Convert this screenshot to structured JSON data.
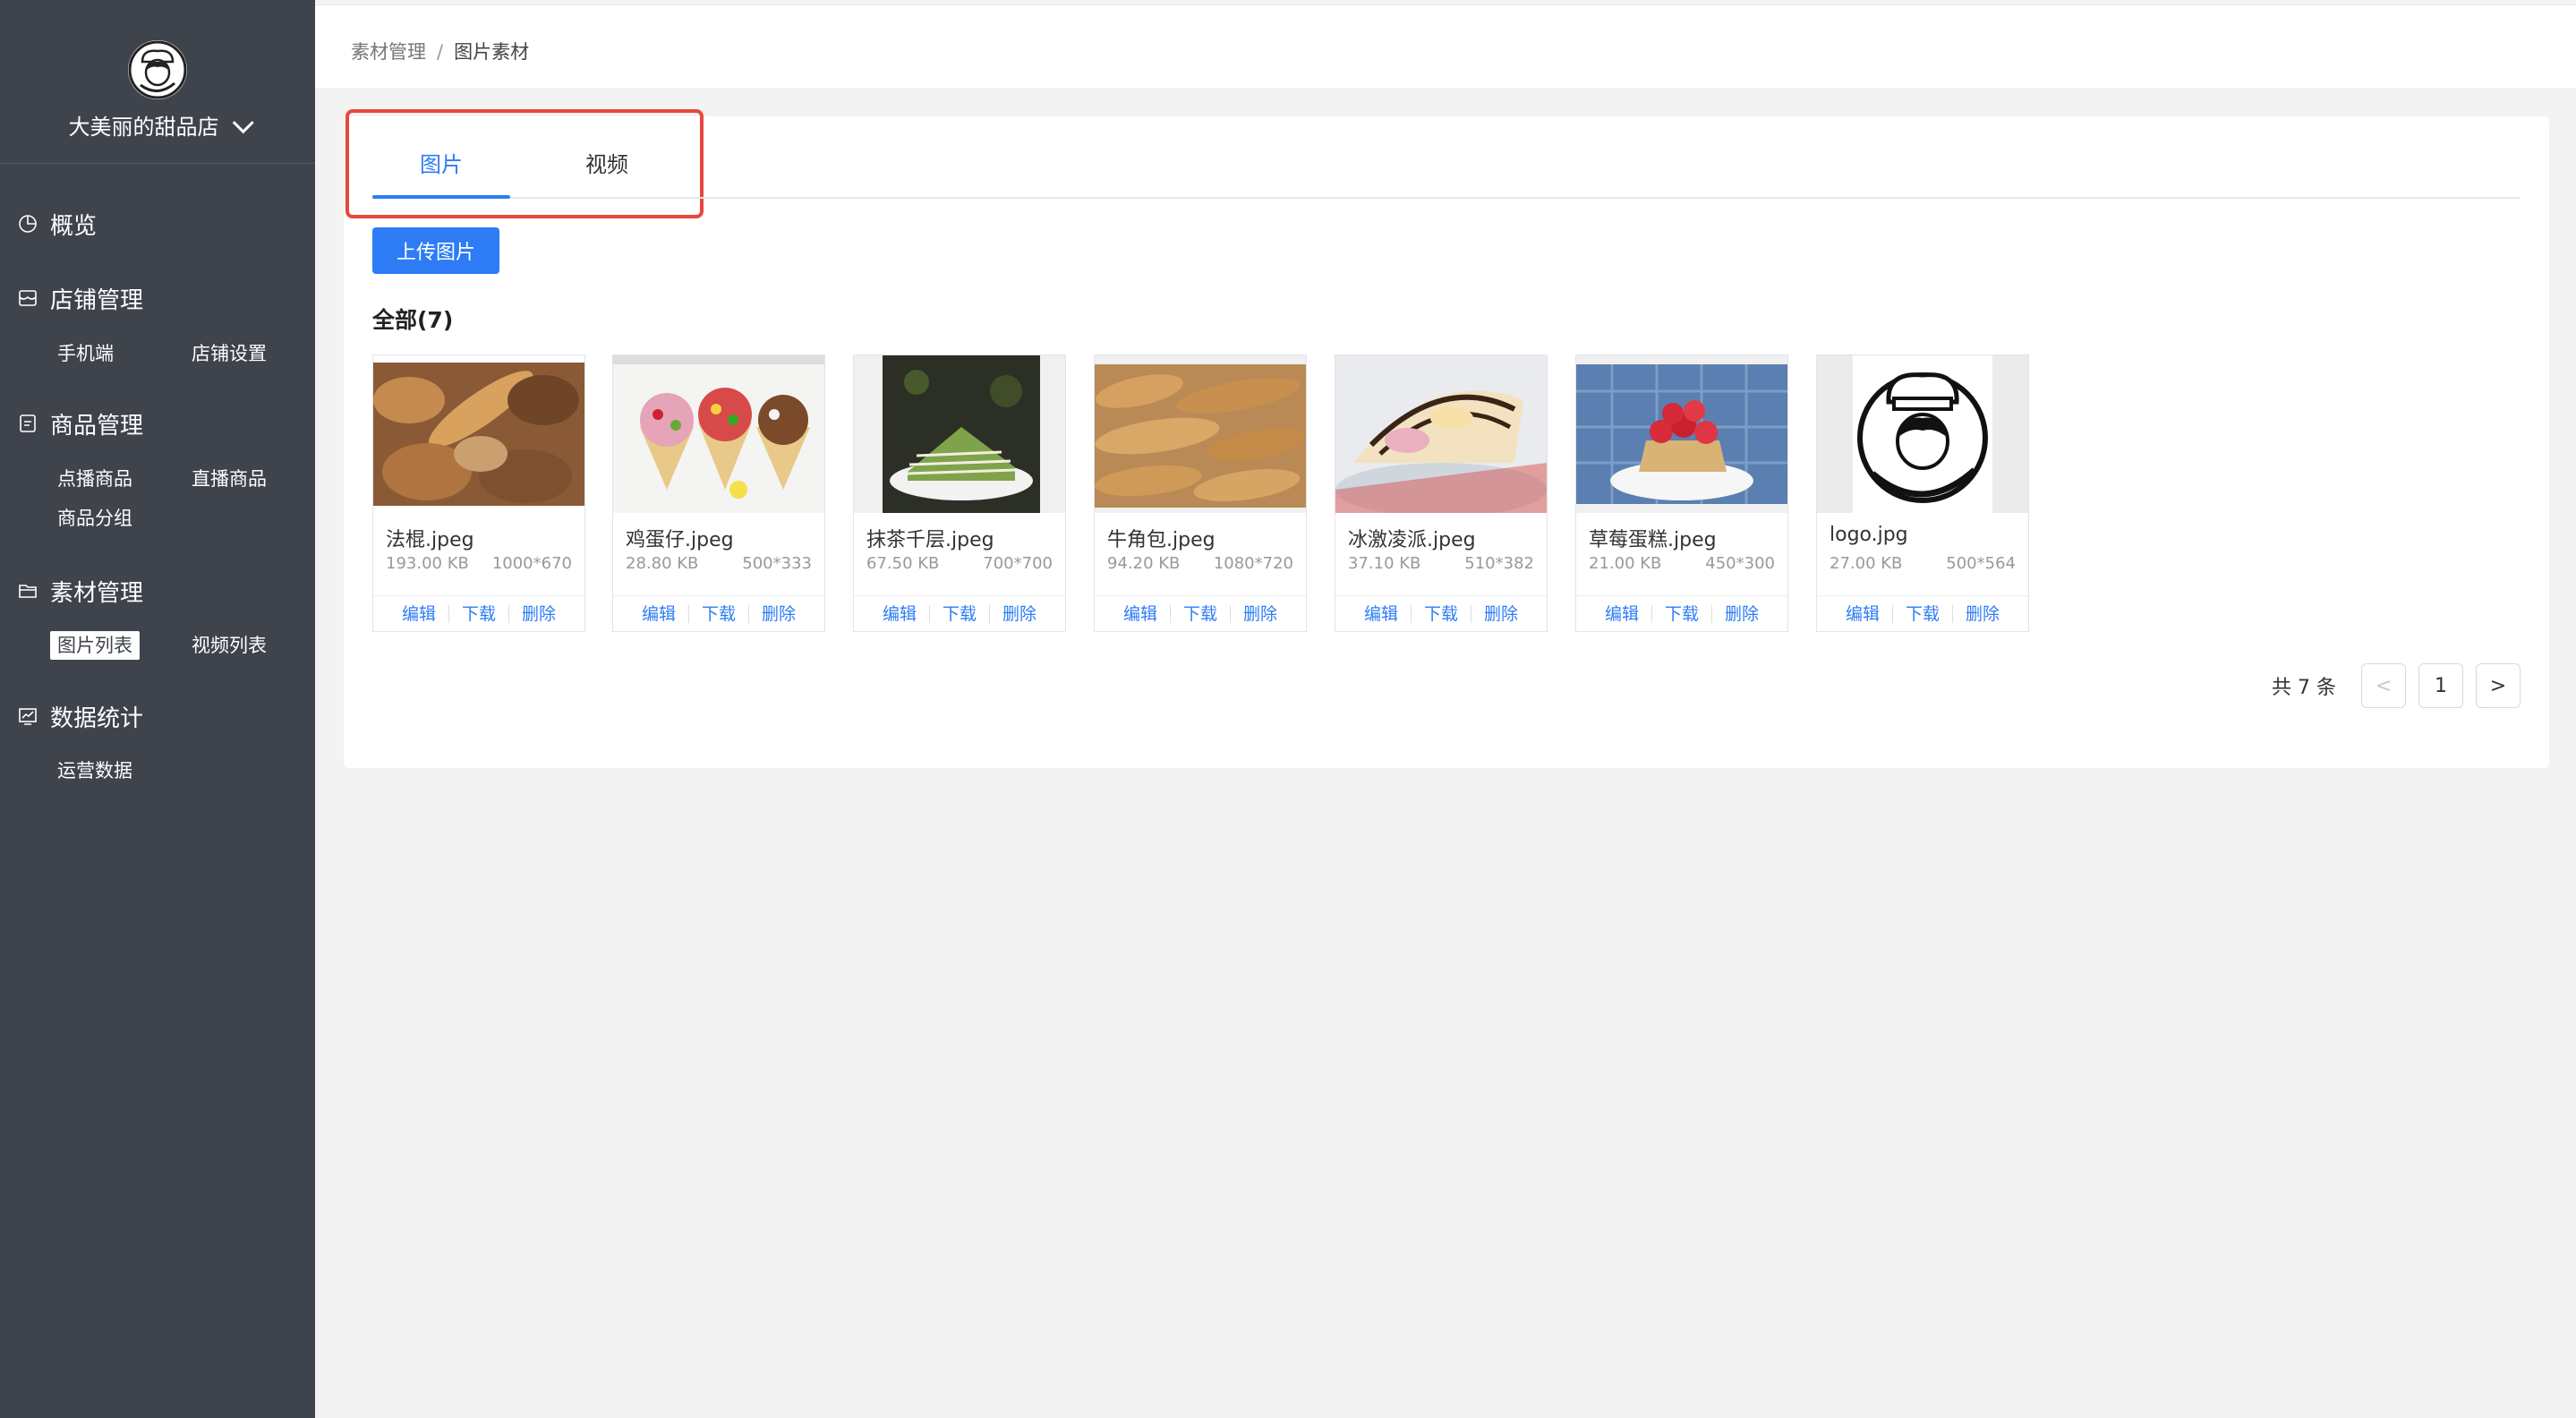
{
  "sidebar": {
    "shop_name": "大美丽的甜品店",
    "menu": [
      {
        "title": "概览",
        "icon": "pie-chart-icon",
        "items": []
      },
      {
        "title": "店铺管理",
        "icon": "store-icon",
        "items": [
          "手机端",
          "店铺设置"
        ]
      },
      {
        "title": "商品管理",
        "icon": "clipboard-icon",
        "items": [
          "点播商品",
          "直播商品",
          "商品分组"
        ]
      },
      {
        "title": "素材管理",
        "icon": "folder-icon",
        "items": [
          "图片列表",
          "视频列表"
        ]
      },
      {
        "title": "数据统计",
        "icon": "chart-icon",
        "items": [
          "运营数据"
        ]
      }
    ],
    "active_item": "图片列表"
  },
  "breadcrumb": {
    "parent": "素材管理",
    "separator": "/",
    "current": "图片素材"
  },
  "tabs": [
    {
      "label": "图片",
      "active": true
    },
    {
      "label": "视频",
      "active": false
    }
  ],
  "upload_label": "上传图片",
  "all_label": "全部(7)",
  "images": [
    {
      "name": "法棍.jpeg",
      "size": "193.00 KB",
      "dim": "1000*670"
    },
    {
      "name": "鸡蛋仔.jpeg",
      "size": "28.80 KB",
      "dim": "500*333"
    },
    {
      "name": "抹茶千层.jpeg",
      "size": "67.50 KB",
      "dim": "700*700"
    },
    {
      "name": "牛角包.jpeg",
      "size": "94.20 KB",
      "dim": "1080*720"
    },
    {
      "name": "冰激凌派.jpeg",
      "size": "37.10 KB",
      "dim": "510*382"
    },
    {
      "name": "草莓蛋糕.jpeg",
      "size": "21.00 KB",
      "dim": "450*300"
    },
    {
      "name": "logo.jpg",
      "size": "27.00 KB",
      "dim": "500*564"
    }
  ],
  "actions": {
    "edit": "编辑",
    "download": "下载",
    "delete": "删除"
  },
  "pager": {
    "total": "共 7 条",
    "page": "1",
    "prev": "<",
    "next": ">"
  },
  "colors": {
    "sidebar": "#3e434c",
    "accent": "#2d7cf6",
    "highlight": "#e8473c"
  }
}
